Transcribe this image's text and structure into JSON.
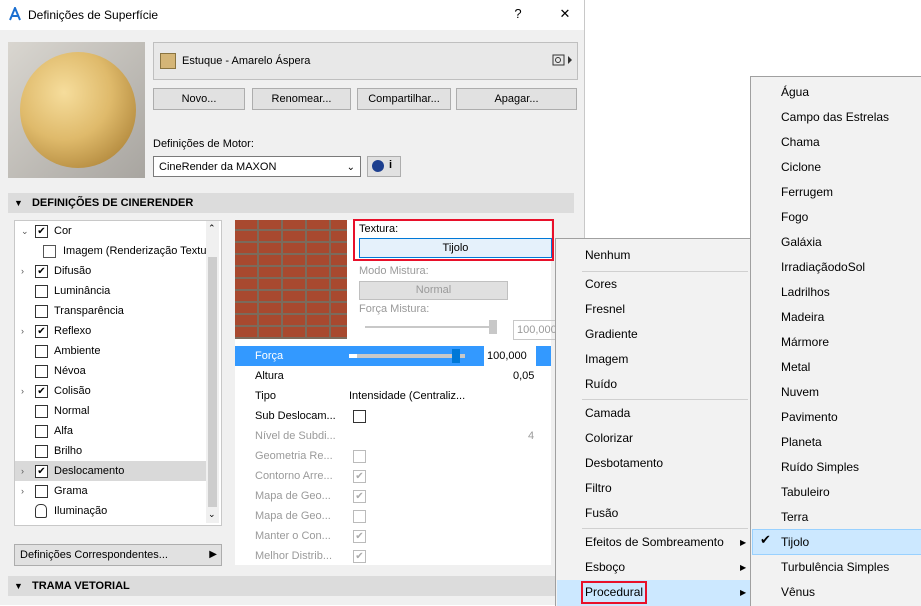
{
  "window": {
    "title": "Definições de Superfície",
    "help": "?",
    "close": "✕"
  },
  "material": {
    "name": "Estuque - Amarelo Áspera",
    "swatch_color": "#d4b577"
  },
  "buttons": {
    "new": "Novo...",
    "rename": "Renomear...",
    "share": "Compartilhar...",
    "delete": "Apagar..."
  },
  "engine": {
    "label": "Definições de Motor:",
    "value": "CineRender da MAXON",
    "info": "i"
  },
  "sections": {
    "cinerender": "DEFINIÇÕES DE CINERENDER",
    "vector": "TRAMA VETORIAL"
  },
  "channels": [
    {
      "label": "Cor",
      "checked": true
    },
    {
      "label": "Imagem (Renderização Textu"
    },
    {
      "label": "Difusão",
      "checked": true
    },
    {
      "label": "Luminância",
      "checked": false
    },
    {
      "label": "Transparência",
      "checked": false
    },
    {
      "label": "Reflexo",
      "checked": true
    },
    {
      "label": "Ambiente",
      "checked": false
    },
    {
      "label": "Névoa",
      "checked": false
    },
    {
      "label": "Colisão",
      "checked": true
    },
    {
      "label": "Normal",
      "checked": false
    },
    {
      "label": "Alfa",
      "checked": false
    },
    {
      "label": "Brilho",
      "checked": false
    },
    {
      "label": "Deslocamento",
      "checked": true
    },
    {
      "label": "Grama",
      "checked": false
    },
    {
      "label": "Iluminação"
    }
  ],
  "correspondences": "Definições Correspondentes...",
  "texture": {
    "label": "Textura:",
    "value": "Tijolo",
    "mix_mode_label": "Modo Mistura:",
    "mix_mode_value": "Normal",
    "mix_strength_label": "Força Mistura:",
    "mix_strength_value": "100,000"
  },
  "props": {
    "strength": {
      "label": "Força",
      "value": "100,000",
      "level": 0.95
    },
    "height": {
      "label": "Altura",
      "value": "0,05"
    },
    "type": {
      "label": "Tipo",
      "value": "Intensidade (Centraliz..."
    },
    "sub": {
      "label": "Sub Deslocam..."
    },
    "subdiv": {
      "label": "Nível de Subdi...",
      "value": "4"
    },
    "geo": {
      "label": "Geometria Re..."
    },
    "contour": {
      "label": "Contorno Arre..."
    },
    "map1": {
      "label": "Mapa de Geo..."
    },
    "map2": {
      "label": "Mapa de Geo..."
    },
    "keep": {
      "label": "Manter o Con..."
    },
    "best": {
      "label": "Melhor Distrib..."
    }
  },
  "menu1": [
    "Nenhum",
    "Cores",
    "Fresnel",
    "Gradiente",
    "Imagem",
    "Ruído",
    "Camada",
    "Colorizar",
    "Desbotamento",
    "Filtro",
    "Fusão",
    "Efeitos de Sombreamento",
    "Esboço",
    "Procedural"
  ],
  "menu2": [
    "Água",
    "Campo das Estrelas",
    "Chama",
    "Ciclone",
    "Ferrugem",
    "Fogo",
    "Galáxia",
    "IrradiaçãodoSol",
    "Ladrilhos",
    "Madeira",
    "Mármore",
    "Metal",
    "Nuvem",
    "Pavimento",
    "Planeta",
    "Ruído Simples",
    "Tabuleiro",
    "Terra",
    "Tijolo",
    "Turbulência Simples",
    "Vênus"
  ],
  "menu2_selected": "Tijolo",
  "colors": {
    "accent": "#3399ff",
    "highlight": "#cce8ff",
    "red": "#e8102a"
  }
}
